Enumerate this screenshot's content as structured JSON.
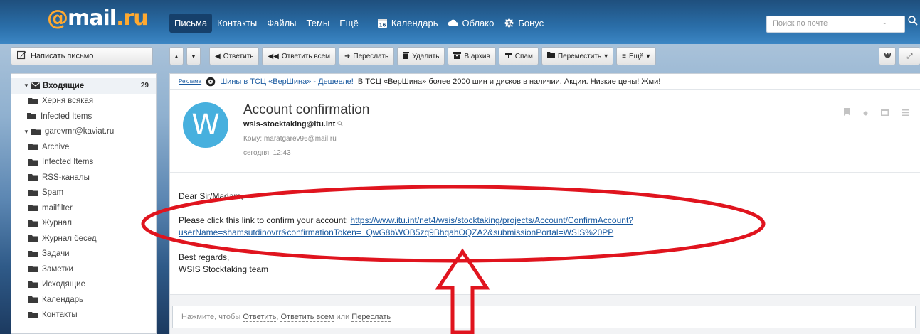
{
  "logo": {
    "at": "@",
    "main": "mail",
    "dot": ".",
    "ru": "ru"
  },
  "nav": {
    "items": [
      {
        "label": "Письма",
        "active": true
      },
      {
        "label": "Контакты"
      },
      {
        "label": "Файлы"
      },
      {
        "label": "Темы"
      },
      {
        "label": "Ещё"
      }
    ],
    "calendar": "Календарь",
    "calendar_day": "16",
    "cloud": "Облако",
    "bonus": "Бонус"
  },
  "search": {
    "placeholder": "Поиск по почте",
    "dropdown": "-"
  },
  "compose_label": "Написать письмо",
  "toolbar": {
    "reply": "Ответить",
    "reply_all": "Ответить всем",
    "forward": "Переслать",
    "delete": "Удалить",
    "archive": "В архив",
    "spam": "Спам",
    "move": "Переместить",
    "more": "Ещё"
  },
  "sidebar": {
    "inbox": {
      "label": "Входящие",
      "count": "29"
    },
    "items": [
      {
        "label": "Херня всякая",
        "indent": 1
      },
      {
        "label": "Infected Items",
        "indent": 0
      },
      {
        "label": "garevmr@kaviat.ru",
        "indent": 0,
        "expanded": true
      },
      {
        "label": "Archive",
        "indent": 1
      },
      {
        "label": "Infected Items",
        "indent": 1
      },
      {
        "label": "RSS-каналы",
        "indent": 1
      },
      {
        "label": "Spam",
        "indent": 1
      },
      {
        "label": "mailfilter",
        "indent": 1
      },
      {
        "label": "Журнал",
        "indent": 1
      },
      {
        "label": "Журнал бесед",
        "indent": 1
      },
      {
        "label": "Задачи",
        "indent": 1
      },
      {
        "label": "Заметки",
        "indent": 1
      },
      {
        "label": "Исходящие",
        "indent": 1
      },
      {
        "label": "Календарь",
        "indent": 1
      },
      {
        "label": "Контакты",
        "indent": 1
      }
    ]
  },
  "ad": {
    "label": "Реклама",
    "link": "Шины в ТСЦ «ВерШина» - Дешевле!",
    "text": "В ТСЦ «ВерШина» более 2000 шин и дисков в наличии. Акции. Низкие цены! Жми!"
  },
  "message": {
    "avatar_letter": "W",
    "subject": "Account confirmation",
    "sender": "wsis-stocktaking@itu.int",
    "to": "Кому: maratgarev96@mail.ru",
    "date": "сегодня, 12:43",
    "greeting": "Dear Sir/Madam,",
    "confirm_prefix": "Please click this link to confirm your account:",
    "link_line1": "https://www.itu.int/net4/wsis/stocktaking/projects/Account/ConfirmAccount?",
    "link_line2": "userName=shamsutdinovrr&confirmationToken=_QwG8bWOB5zq9BhqahOQZA2&submissionPortal=WSIS%20PP",
    "regards": "Best regards,",
    "signature": "WSIS Stocktaking team"
  },
  "reply": {
    "prefix": "Нажмите, чтобы",
    "reply": "Ответить",
    "comma": ",",
    "reply_all": "Ответить всем",
    "or": "или",
    "forward": "Переслать"
  },
  "colors": {
    "accent": "#2a6ea8",
    "annotation": "#e0141e",
    "link": "#1a5aa0",
    "avatar": "#47b0de"
  }
}
